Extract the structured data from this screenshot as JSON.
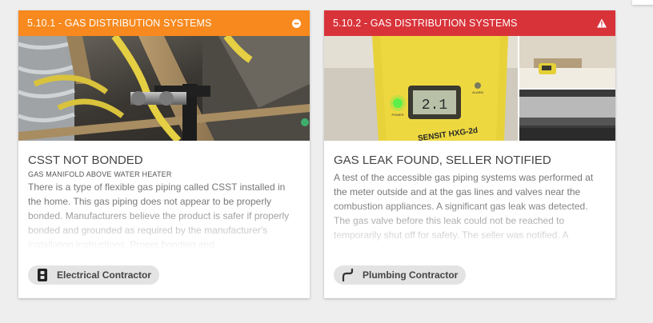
{
  "cards": [
    {
      "header": "5.10.1 - GAS DISTRIBUTION SYSTEMS",
      "header_color": "#f7891e",
      "header_icon": "minus-circle-icon",
      "title": "CSST NOT BONDED",
      "subtitle": "GAS MANIFOLD ABOVE WATER HEATER",
      "description": "There is a type of flexible gas piping called CSST installed in the home.  This gas piping  does not appear to be properly bonded.  Manufacturers believe the product is safer if properly bonded and grounded as required by the manufacturer's installation instructions. Proper bonding and",
      "chip_label": "Electrical Contractor",
      "chip_icon": "electrical-panel-icon"
    },
    {
      "header": "5.10.2 - GAS DISTRIBUTION SYSTEMS",
      "header_color": "#d9333a",
      "header_icon": "warning-triangle-icon",
      "title": "GAS LEAK FOUND, SELLER NOTIFIED",
      "subtitle": "",
      "description": "A test of the accessible gas piping systems was performed at the meter outside and at the gas lines and valves near the combustion appliances.  A significant gas leak was detected.  The gas valve before this leak could not be reached to temporarily shut off for safety. The seller was notified.  A",
      "chip_label": "Plumbing Contractor",
      "chip_icon": "pipe-icon",
      "photo_text": {
        "display": "2.1",
        "brand": "SENSIT HXG-2d",
        "alarm": "ALARM",
        "power": "POWER"
      }
    }
  ]
}
